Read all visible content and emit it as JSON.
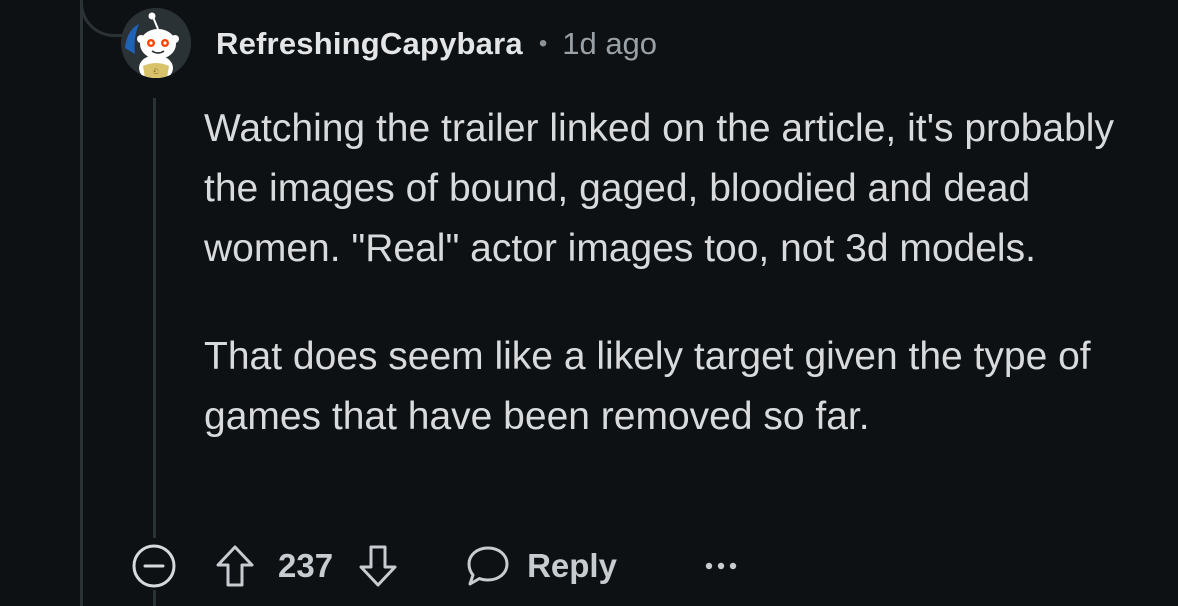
{
  "comment": {
    "username": "RefreshingCapybara",
    "separator": "•",
    "timestamp": "1d ago",
    "avatar_icon": "snoo-avatar-icon",
    "paragraphs": [
      "Watching the trailer linked on the article, it's probably the images of bound, gaged, bloodied and dead women. \"Real\" actor images too, not 3d models.",
      "That does seem like a likely target given the type of games that have been removed so far."
    ]
  },
  "actions": {
    "collapse_icon": "collapse-minus-icon",
    "upvote_icon": "upvote-arrow-icon",
    "score": "237",
    "downvote_icon": "downvote-arrow-icon",
    "reply_icon": "speech-bubble-icon",
    "reply_label": "Reply",
    "more_icon": "more-dots-icon"
  },
  "colors": {
    "background": "#0e1113",
    "text": "#d8dadc",
    "muted": "#9aa1a6",
    "thread_line": "#2a3236"
  }
}
